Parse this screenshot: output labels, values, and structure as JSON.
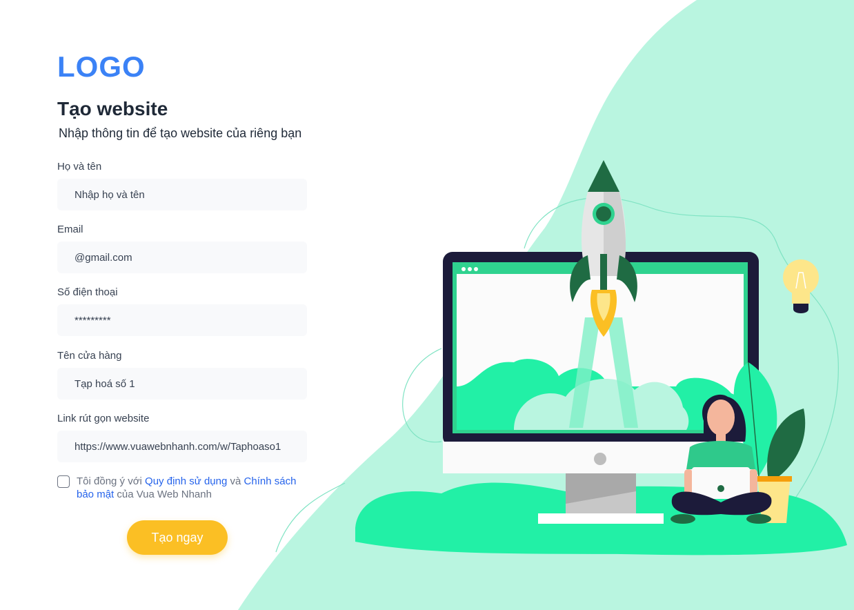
{
  "logo": "LOGO",
  "header": {
    "title": "Tạo website",
    "subtitle": "Nhập thông tin để tạo website của riêng bạn"
  },
  "form": {
    "full_name": {
      "label": "Họ và tên",
      "placeholder": "Nhập họ và tên",
      "value": ""
    },
    "email": {
      "label": "Email",
      "placeholder": "@gmail.com",
      "value": ""
    },
    "phone": {
      "label": "Số điện thoại",
      "placeholder": "*********",
      "value": ""
    },
    "store_name": {
      "label": "Tên cửa hàng",
      "placeholder": "Tạp hoá số 1",
      "value": ""
    },
    "short_link": {
      "label": "Link rút gọn website",
      "placeholder": "https://www.vuawebnhanh.com/w/Taphoaso1",
      "value": ""
    }
  },
  "consent": {
    "prefix": "Tôi đồng ý với ",
    "terms_link": "Quy định sử dụng",
    "middle": " và ",
    "privacy_link": "Chính sách bảo mật",
    "suffix": " của Vua Web Nhanh",
    "checked": false
  },
  "submit_label": "Tạo ngay",
  "colors": {
    "brand_blue": "#3b82f6",
    "accent_yellow": "#fbbf24",
    "mint_background": "#b9f5e0",
    "green_ground": "#22f0a6"
  },
  "illustration": {
    "icons": [
      "rocket-icon",
      "monitor-icon",
      "lightbulb-icon",
      "plant-icon",
      "person-with-laptop-icon"
    ]
  }
}
